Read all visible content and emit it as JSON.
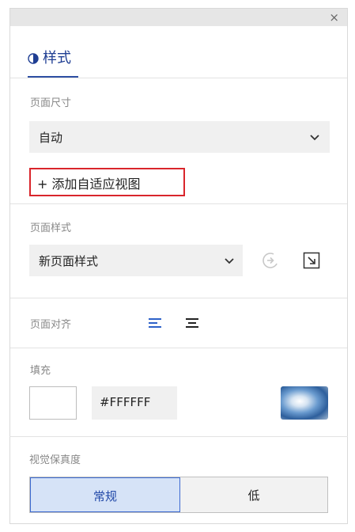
{
  "panel": {
    "close_label": "×"
  },
  "tabs": {
    "style_label": "样式"
  },
  "page_size": {
    "label": "页面尺寸",
    "selected": "自动",
    "add_view_label": "+ 添加自适应视图"
  },
  "page_style": {
    "label": "页面样式",
    "selected": "新页面样式"
  },
  "page_align": {
    "label": "页面对齐"
  },
  "fill": {
    "label": "填充",
    "hex_value": "#FFFFFF",
    "color": "#FFFFFF"
  },
  "visual_fidelity": {
    "label": "视觉保真度",
    "options": [
      "常规",
      "低"
    ],
    "selected": "常规"
  },
  "colors": {
    "accent": "#2E4FA3",
    "highlight_border": "#D9252B"
  }
}
